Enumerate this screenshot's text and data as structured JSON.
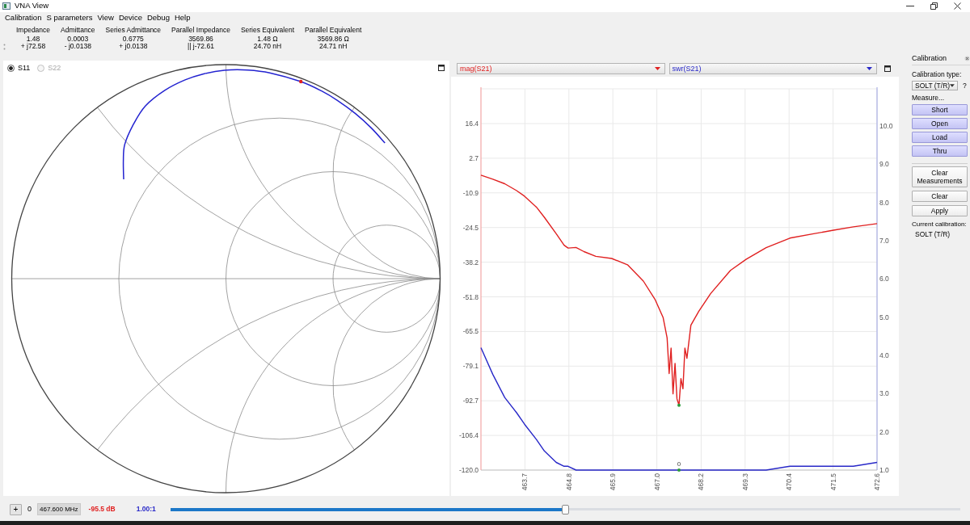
{
  "window": {
    "title": "VNA View"
  },
  "menu": [
    "Calibration",
    "S parameters",
    "View",
    "Device",
    "Debug",
    "Help"
  ],
  "measurements": [
    {
      "heading": "Impedance",
      "lines": [
        "1.48",
        "+ j72.58"
      ]
    },
    {
      "heading": "Admittance",
      "lines": [
        "0.0003",
        "- j0.0138"
      ]
    },
    {
      "heading": "Series Admittance",
      "lines": [
        "0.6775",
        "+ j0.0138"
      ]
    },
    {
      "heading": "Parallel Impedance",
      "lines": [
        "3569.86",
        "|| j-72.61"
      ]
    },
    {
      "heading": "Series Equivalent",
      "lines": [
        "1.48 Ω",
        "24.70 nH"
      ]
    },
    {
      "heading": "Parallel Equivalent",
      "lines": [
        "3569.86 Ω",
        "24.71 nH"
      ]
    }
  ],
  "smith_chart": {
    "traces": [
      {
        "label": "S11",
        "selected": true,
        "disabled": false
      },
      {
        "label": "S22",
        "selected": false,
        "disabled": true
      }
    ]
  },
  "plot": {
    "chart_data": {
      "type": "line",
      "grid": true,
      "x": [
        462.6,
        462.9,
        463.2,
        463.5,
        463.7,
        464.0,
        464.2,
        464.5,
        464.7,
        464.8,
        465.0,
        465.2,
        465.5,
        465.9,
        466.3,
        466.7,
        467.0,
        467.2,
        467.3,
        467.35,
        467.4,
        467.45,
        467.5,
        467.55,
        467.6,
        467.65,
        467.7,
        467.75,
        467.8,
        467.9,
        468.1,
        468.4,
        468.9,
        469.3,
        469.8,
        470.4,
        471.0,
        471.5,
        472.0,
        472.6
      ],
      "series": [
        {
          "name": "mag(S21)",
          "color": "#e02020",
          "values": [
            -3.9,
            -5.5,
            -7.3,
            -10.0,
            -12.2,
            -16.5,
            -20.5,
            -27.0,
            -31.5,
            -32.6,
            -32.4,
            -34.0,
            -35.9,
            -36.7,
            -39.2,
            -45.6,
            -53.0,
            -60.0,
            -68.0,
            -82.0,
            -72.0,
            -90.0,
            -78.0,
            -92.0,
            -94.5,
            -84.0,
            -88.0,
            -72.0,
            -76.0,
            -63.0,
            -57.5,
            -50.5,
            -41.4,
            -37.0,
            -32.5,
            -28.7,
            -27.0,
            -25.6,
            -24.3,
            -23.0
          ]
        },
        {
          "name": "swr(S21)",
          "color": "#2828c8",
          "axis": "y2",
          "values": [
            4.2,
            3.5,
            2.9,
            2.5,
            2.2,
            1.8,
            1.5,
            1.2,
            1.1,
            1.1,
            1.0,
            1.0,
            1.0,
            1.0,
            1.0,
            1.0,
            1.0,
            1.0,
            1.0,
            1.0,
            1.0,
            1.0,
            1.0,
            1.0,
            1.0,
            1.0,
            1.0,
            1.0,
            1.0,
            1.0,
            1.0,
            1.0,
            1.0,
            1.0,
            1.0,
            1.1,
            1.1,
            1.1,
            1.1,
            1.2
          ]
        }
      ],
      "xlim": [
        462.6,
        472.6
      ],
      "ylim": [
        -120,
        30.04
      ],
      "y2lim": [
        1,
        10.97
      ],
      "xticks": [
        {
          "value": 463.71,
          "label": "463.7"
        },
        {
          "value": 464.82,
          "label": "464.8"
        },
        {
          "value": 465.93,
          "label": "465.9"
        },
        {
          "value": 467.04,
          "label": "467.0"
        },
        {
          "value": 468.16,
          "label": "468.2"
        },
        {
          "value": 469.27,
          "label": "469.3"
        },
        {
          "value": 470.38,
          "label": "470.4"
        },
        {
          "value": 471.49,
          "label": "471.5"
        },
        {
          "value": 472.6,
          "label": "472.6"
        }
      ],
      "yticks": [
        {
          "value": -120,
          "label": "-120.0"
        },
        {
          "value": -106.36,
          "label": "-106.4"
        },
        {
          "value": -92.73,
          "label": "-92.7"
        },
        {
          "value": -79.09,
          "label": "-79.1"
        },
        {
          "value": -65.45,
          "label": "-65.5"
        },
        {
          "value": -51.82,
          "label": "-51.8"
        },
        {
          "value": -38.18,
          "label": "-38.2"
        },
        {
          "value": -24.55,
          "label": "-24.5"
        },
        {
          "value": -10.91,
          "label": "-10.9"
        },
        {
          "value": 2.73,
          "label": "2.7"
        },
        {
          "value": 16.36,
          "label": "16.4"
        }
      ],
      "y2ticks": [
        {
          "value": 1,
          "label": "1.0"
        },
        {
          "value": 2,
          "label": "2.0"
        },
        {
          "value": 3,
          "label": "3.0"
        },
        {
          "value": 4,
          "label": "4.0"
        },
        {
          "value": 5,
          "label": "5.0"
        },
        {
          "value": 6,
          "label": "6.0"
        },
        {
          "value": 7,
          "label": "7.0"
        },
        {
          "value": 8,
          "label": "8.0"
        },
        {
          "value": 9,
          "label": "9.0"
        },
        {
          "value": 10,
          "label": "10.0"
        }
      ],
      "annotations": [
        "0"
      ]
    }
  },
  "calibration": {
    "title": "Calibration",
    "type_label": "Calibration type:",
    "type_value": "SOLT (T/R)",
    "help": "?",
    "measure_label": "Measure...",
    "standards": [
      "Short",
      "Open",
      "Load",
      "Thru"
    ],
    "actions": [
      "Clear Measurements",
      "Clear",
      "Apply"
    ],
    "current_label": "Current calibration:",
    "current_value": "SOLT (T/R)"
  },
  "bottom_bar": {
    "add_button": "+",
    "marker_index": "0",
    "frequency": "467.600 MHz",
    "magnitude": "-95.5 dB",
    "swr": "1.00:1",
    "slider": {
      "level": 0.5
    }
  }
}
